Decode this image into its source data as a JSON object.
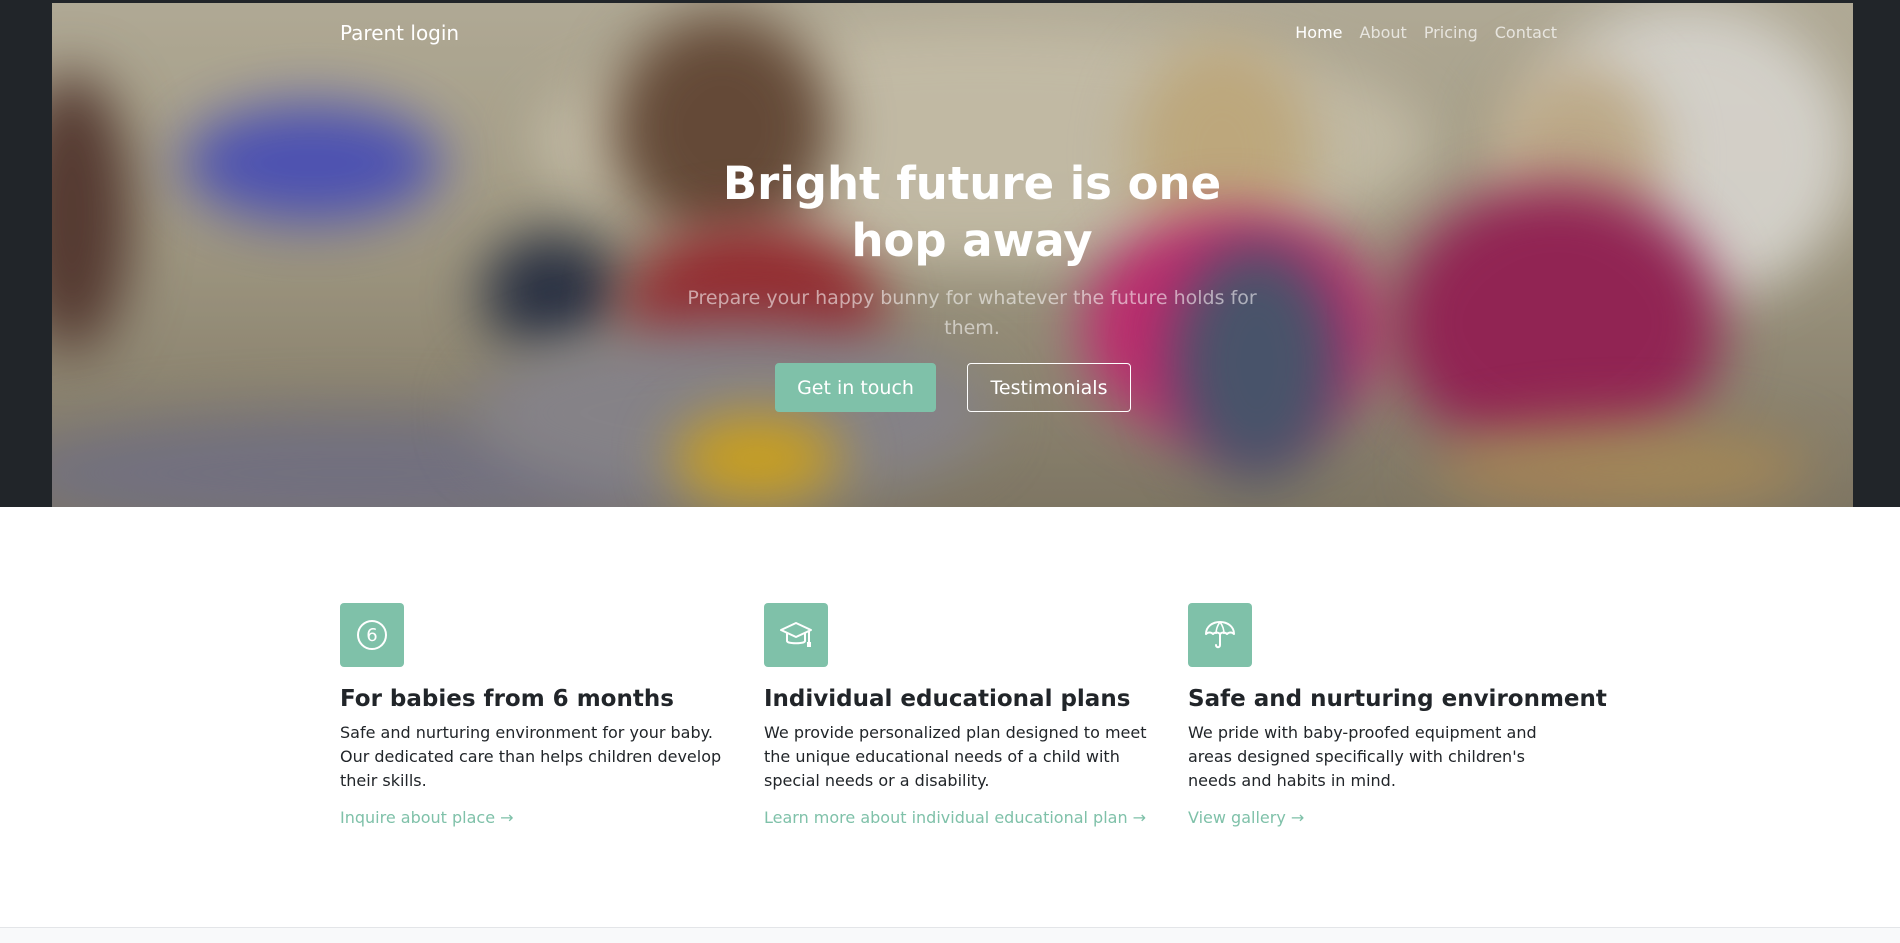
{
  "nav": {
    "brand": "Parent login",
    "links": [
      {
        "label": "Home",
        "active": true
      },
      {
        "label": "About",
        "active": false
      },
      {
        "label": "Pricing",
        "active": false
      },
      {
        "label": "Contact",
        "active": false
      }
    ]
  },
  "hero": {
    "title": "Bright future is one hop away",
    "subtitle": "Prepare your happy bunny for whatever the future holds for them.",
    "primary_button": "Get in touch",
    "secondary_button": "Testimonials"
  },
  "features": [
    {
      "icon": "number-6-icon",
      "title": "For babies from 6 months",
      "description": "Safe and nurturing environment for your baby. Our dedicated care than helps children develop their skills.",
      "link": "Inquire about place →"
    },
    {
      "icon": "graduation-cap-icon",
      "title": "Individual educational plans",
      "description": "We provide personalized plan designed to meet the unique educational needs of a child with special needs or a disability.",
      "link": "Learn more about individual educational plan →"
    },
    {
      "icon": "umbrella-icon",
      "title": "Safe and nurturing environment",
      "description": "We pride with baby-proofed equipment and areas designed specifically with children's needs and habits in mind.",
      "link": "View gallery →"
    }
  ],
  "colors": {
    "accent": "#7fc1a9",
    "dark": "#212529"
  }
}
